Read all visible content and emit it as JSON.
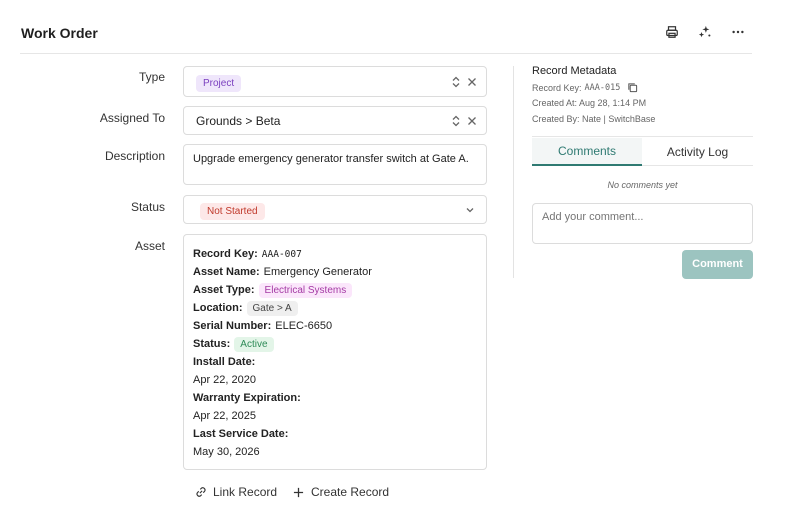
{
  "page": {
    "title": "Work Order"
  },
  "toolbar": {
    "print_icon": "printer-icon",
    "magic_icon": "sparkles-icon",
    "more_icon": "ellipsis-icon"
  },
  "form": {
    "type": {
      "label": "Type",
      "value": "Project"
    },
    "assigned": {
      "label": "Assigned To",
      "value": "Grounds > Beta"
    },
    "description": {
      "label": "Description",
      "value": "Upgrade emergency generator transfer switch at Gate A."
    },
    "status": {
      "label": "Status",
      "value": "Not Started"
    },
    "asset": {
      "label": "Asset",
      "record_key_label": "Record Key:",
      "record_key": "AAA-007",
      "asset_name_label": "Asset Name:",
      "asset_name": "Emergency Generator",
      "asset_type_label": "Asset Type:",
      "asset_type": "Electrical Systems",
      "location_label": "Location:",
      "location": "Gate > A",
      "serial_label": "Serial Number:",
      "serial": "ELEC-6650",
      "status_label": "Status:",
      "status": "Active",
      "install_label": "Install Date:",
      "install": "Apr 22, 2020",
      "warranty_label": "Warranty Expiration:",
      "warranty": "Apr 22, 2025",
      "service_label": "Last Service Date:",
      "service": "May 30, 2026"
    },
    "link_record": "Link Record",
    "create_record": "Create Record"
  },
  "meta": {
    "title": "Record Metadata",
    "record_key_label": "Record Key:",
    "record_key": "AAA-015",
    "created_at": "Created At: Aug 28, 1:14 PM",
    "created_by": "Created By: Nate | SwitchBase"
  },
  "tabs": {
    "comments": "Comments",
    "activity": "Activity Log"
  },
  "comments": {
    "empty": "No comments yet",
    "placeholder": "Add your comment...",
    "submit": "Comment"
  },
  "colors": {
    "project_bg": "#efe6fb",
    "project_fg": "#7a3fbf",
    "notstarted_bg": "#fde8e8",
    "notstarted_fg": "#c0392b",
    "assettype_bg": "#fbe6fb",
    "assettype_fg": "#a43aa4",
    "active_bg": "#e3f5e8",
    "active_fg": "#2e8b57",
    "accent": "#2f7a72",
    "button": "#9cc4c0"
  }
}
